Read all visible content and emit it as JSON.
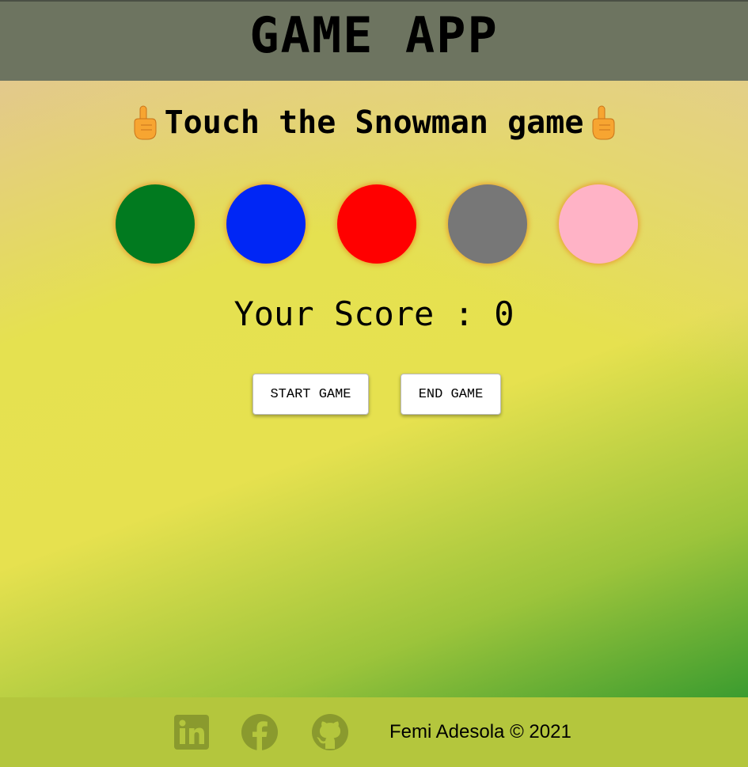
{
  "header": {
    "title": "GAME APP"
  },
  "game": {
    "subtitle": "Touch the Snowman game",
    "circles": [
      {
        "color": "#017a1f",
        "name": "green"
      },
      {
        "color": "#0026f5",
        "name": "blue"
      },
      {
        "color": "#ff0000",
        "name": "red"
      },
      {
        "color": "#777777",
        "name": "gray"
      },
      {
        "color": "#ffb3c6",
        "name": "pink"
      }
    ],
    "score_text": "Your Score : 0",
    "start_label": "START GAME",
    "end_label": "END GAME"
  },
  "footer": {
    "icons": [
      "linkedin-icon",
      "facebook-icon",
      "github-icon"
    ],
    "copyright": "Femi Adesola © 2021"
  },
  "colors": {
    "header_bg": "#6d7460",
    "footer_bg": "#b4c63d",
    "icon_color": "#8a9a2e"
  }
}
